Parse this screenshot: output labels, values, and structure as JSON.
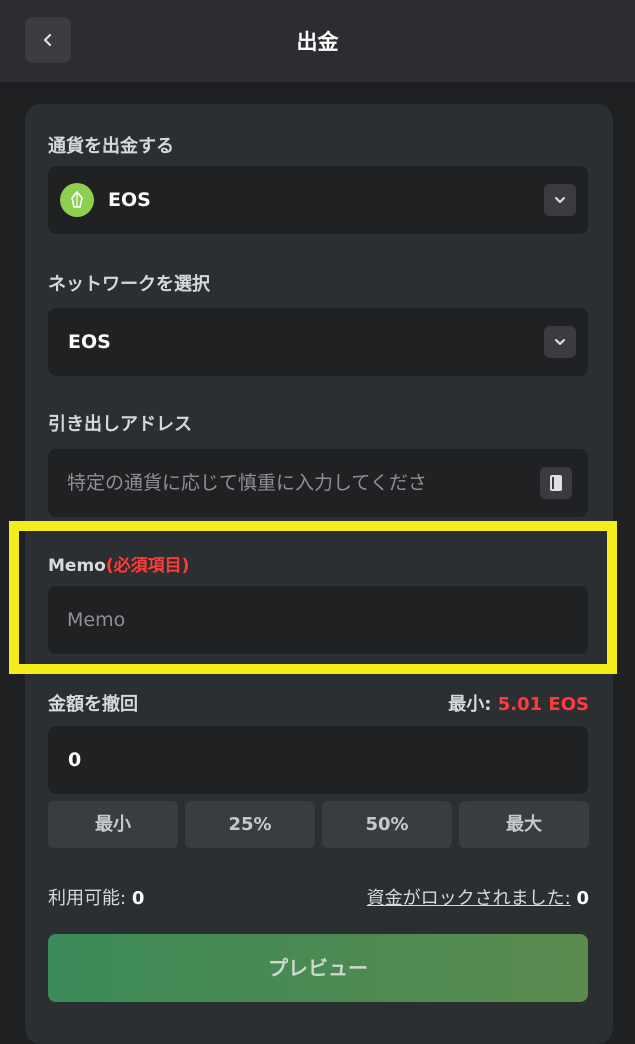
{
  "header": {
    "title": "出金"
  },
  "currency": {
    "label": "通貨を出金する",
    "value": "EOS"
  },
  "network": {
    "label": "ネットワークを選択",
    "value": "EOS"
  },
  "address": {
    "label": "引き出しアドレス",
    "placeholder": "特定の通貨に応じて慎重に入力してくださ"
  },
  "memo": {
    "label": "Memo",
    "required": "(必須項目)",
    "placeholder": "Memo"
  },
  "amount": {
    "label": "金額を撤回",
    "min_label": "最小:",
    "min_value": "5.01 EOS",
    "value": "0"
  },
  "quick_buttons": [
    "最小",
    "25%",
    "50%",
    "最大"
  ],
  "available": {
    "label": "利用可能:",
    "value": "0"
  },
  "locked": {
    "label": "資金がロックされました:",
    "value": "0"
  },
  "preview_button": "プレビュー",
  "colors": {
    "accent": "#3b8a57",
    "required": "#ff3b3b",
    "highlight": "#f5ec1c"
  }
}
